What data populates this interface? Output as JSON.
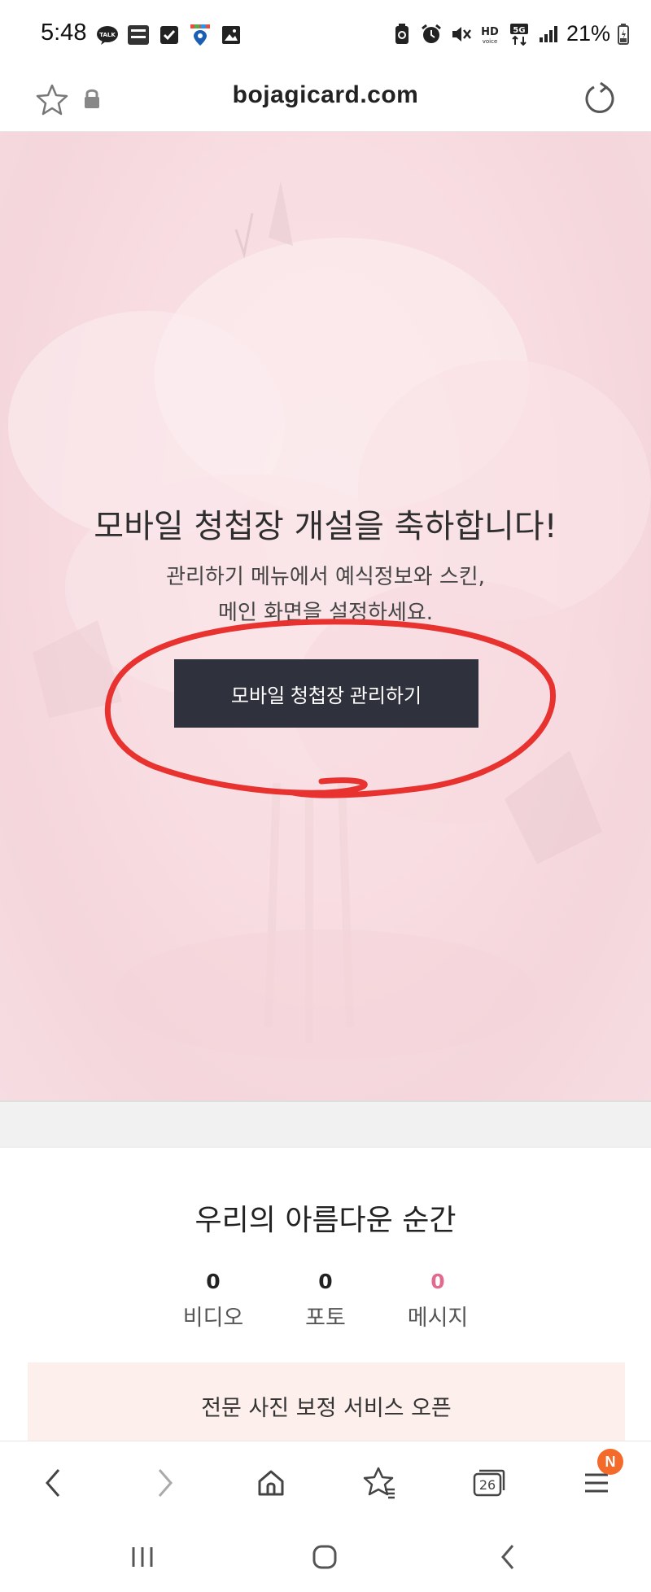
{
  "status_bar": {
    "time": "5:48",
    "left_icons": [
      "talk-icon",
      "app-badge-icon",
      "check-icon",
      "location-icon",
      "gallery-icon"
    ],
    "right_icons": [
      "recycle-icon",
      "alarm-icon",
      "mute-icon",
      "hd-voice-icon",
      "5g-icon",
      "signal-icon"
    ],
    "battery": "21%"
  },
  "url_bar": {
    "domain": "bojagicard.com"
  },
  "hero": {
    "title": "모바일 청첩장 개설을 축하합니다!",
    "subtitle_line1": "관리하기 메뉴에서 예식정보와 스킨,",
    "subtitle_line2": "메인 화면을 설정하세요.",
    "button_label": "모바일 청첩장 관리하기",
    "annotation_color": "#e8322f"
  },
  "moments": {
    "title": "우리의 아름다운 순간",
    "stats": {
      "video": {
        "count": "0",
        "label": "비디오"
      },
      "photo": {
        "count": "0",
        "label": "포토"
      },
      "message": {
        "count": "0",
        "label": "메시지"
      }
    },
    "promo_title": "전문 사진 보정 서비스 오픈"
  },
  "toolbar": {
    "tabs_count": "26",
    "menu_badge": "N"
  },
  "colors": {
    "hero_bg": "#f8dde2",
    "button_bg": "#2f323d",
    "accent_pink": "#e36a8f",
    "badge_orange": "#f46a2a"
  }
}
